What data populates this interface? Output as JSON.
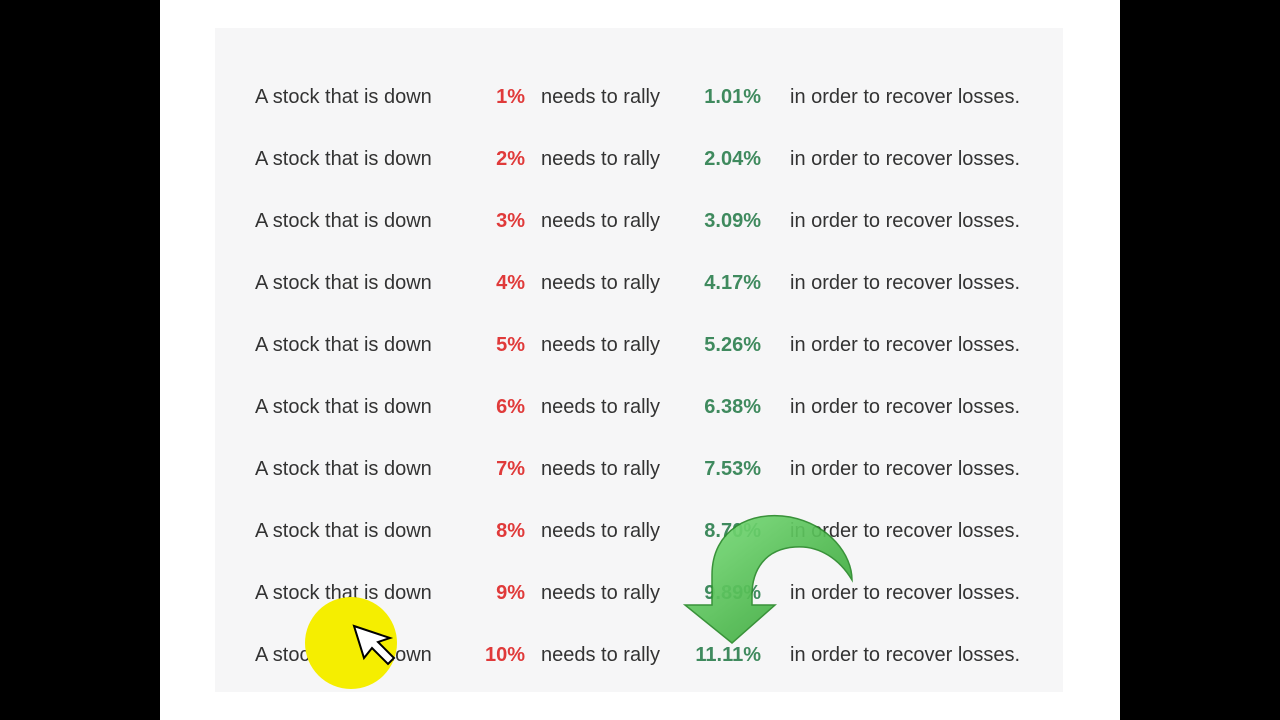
{
  "rows": [
    {
      "prefix": "A stock that  is down",
      "down": "1%",
      "middle": "needs to rally",
      "rally": "1.01%",
      "suffix": "in order to recover losses."
    },
    {
      "prefix": "A stock that  is down",
      "down": "2%",
      "middle": "needs to rally",
      "rally": "2.04%",
      "suffix": "in order to recover losses."
    },
    {
      "prefix": "A stock that  is down",
      "down": "3%",
      "middle": "needs to rally",
      "rally": "3.09%",
      "suffix": "in order to recover losses."
    },
    {
      "prefix": "A stock that  is down",
      "down": "4%",
      "middle": "needs to rally",
      "rally": "4.17%",
      "suffix": "in order to recover losses."
    },
    {
      "prefix": "A stock that  is down",
      "down": "5%",
      "middle": "needs to rally",
      "rally": "5.26%",
      "suffix": "in order to recover losses."
    },
    {
      "prefix": "A stock that  is down",
      "down": "6%",
      "middle": "needs to rally",
      "rally": "6.38%",
      "suffix": "in order to recover losses."
    },
    {
      "prefix": "A stock that  is down",
      "down": "7%",
      "middle": "needs to rally",
      "rally": "7.53%",
      "suffix": "in order to recover losses."
    },
    {
      "prefix": "A stock that  is down",
      "down": "8%",
      "middle": "needs to rally",
      "rally": "8.70%",
      "suffix": "in order to recover losses."
    },
    {
      "prefix": "A stock that  is down",
      "down": "9%",
      "middle": "needs to rally",
      "rally": "9.89%",
      "suffix": "in order to recover losses."
    },
    {
      "prefix": "A stock that  is down",
      "down": "10%",
      "middle": "needs to rally",
      "rally": "11.11%",
      "suffix": "in order to recover losses."
    }
  ],
  "colors": {
    "down": "#e03a3a",
    "rally": "#3f8a5e",
    "arrow": "#3db83d",
    "highlight": "#f5ee00"
  },
  "icons": {
    "arrow": "curved-down-arrow-icon",
    "cursor": "mouse-pointer-icon"
  }
}
